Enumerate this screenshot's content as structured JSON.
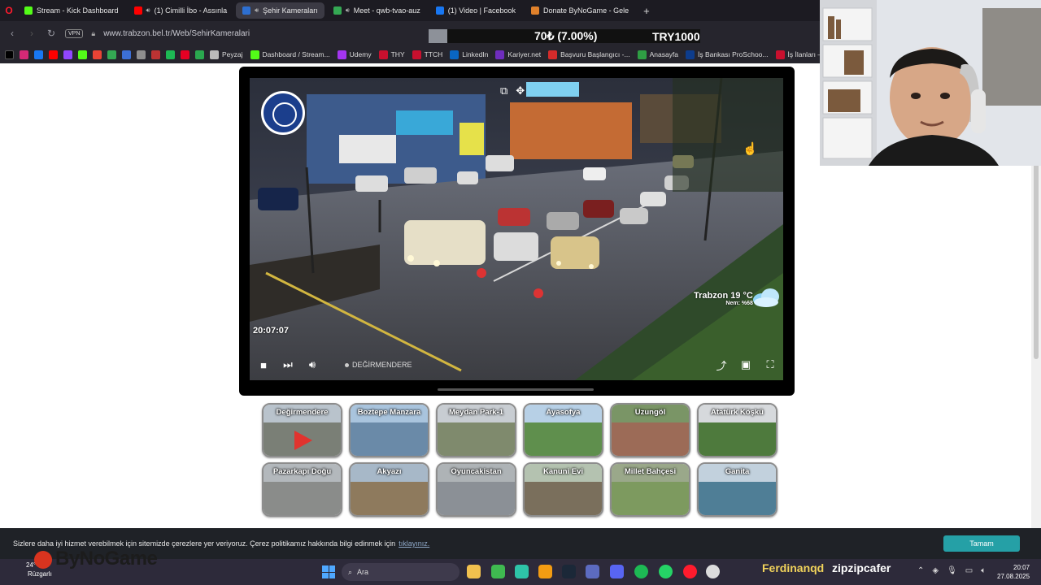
{
  "browser": {
    "tabs": [
      {
        "label": "Stream - Kick Dashboard",
        "color": "#53fc18",
        "audio": false,
        "active": false
      },
      {
        "label": "(1) Cimilli İbo - Assınla",
        "color": "#ff0000",
        "audio": true,
        "active": false
      },
      {
        "label": "Şehir Kameraları",
        "color": "#2d6fd1",
        "audio": true,
        "active": true
      },
      {
        "label": "Meet - qwb-tvao-auz",
        "color": "#34a853",
        "audio": true,
        "active": false
      },
      {
        "label": "(1) Video | Facebook",
        "color": "#1877f2",
        "audio": false,
        "active": false
      },
      {
        "label": "Donate ByNoGame - Gele",
        "color": "#e0812b",
        "audio": false,
        "active": false
      }
    ],
    "new_tab": "+",
    "vpn": "VPN",
    "url": "www.trabzon.bel.tr/Web/SehirKameralari",
    "overlay_goal": "70₺ (7.00%)",
    "overlay_amount": "TRY1000"
  },
  "bookmarks": [
    {
      "label": "Peyzaj",
      "color": "#bbbbbb"
    },
    {
      "label": "Dashboard / Stream...",
      "color": "#53fc18"
    },
    {
      "label": "Udemy",
      "color": "#a435f0"
    },
    {
      "label": "THY",
      "color": "#c8102e"
    },
    {
      "label": "TTCH",
      "color": "#c8102e"
    },
    {
      "label": "LinkedIn",
      "color": "#0a66c2"
    },
    {
      "label": "Kariyer.net",
      "color": "#6f2dbd"
    },
    {
      "label": "Başvuru Başlangıcı -...",
      "color": "#d62b2b"
    },
    {
      "label": "Anasayfa",
      "color": "#2f9e44"
    },
    {
      "label": "İş Bankası ProSchoo...",
      "color": "#0d3c8c"
    },
    {
      "label": "İş İlanları – Ba",
      "color": "#c8102e"
    }
  ],
  "player": {
    "time": "20:07:07",
    "weather_city": "Trabzon 19 °C",
    "weather_humidity": "Nem: %68",
    "live_label": "DEĞİRMENDERE",
    "progress": 0.0
  },
  "cameras": [
    {
      "name": "Değirmendere",
      "sky": "#b9c3cc",
      "ground": "#7a7f76",
      "playing": true
    },
    {
      "name": "Boztepe Manzara",
      "sky": "#a9c4dd",
      "ground": "#6a8aa8",
      "playing": false
    },
    {
      "name": "Meydan Park-1",
      "sky": "#c8cdd2",
      "ground": "#7f8a6d",
      "playing": false
    },
    {
      "name": "Ayasofya",
      "sky": "#b7d0e6",
      "ground": "#5f8f4d",
      "playing": false
    },
    {
      "name": "Uzungöl",
      "sky": "#7a9566",
      "ground": "#9c6b57",
      "playing": false
    },
    {
      "name": "Atatürk Köşkü",
      "sky": "#d6d9dc",
      "ground": "#4e7a3d",
      "playing": false
    },
    {
      "name": "Pazarkapı Doğu",
      "sky": "#b3b8bc",
      "ground": "#8a8c8a",
      "playing": false
    },
    {
      "name": "Akyazı",
      "sky": "#a7b8c8",
      "ground": "#8e7a5d",
      "playing": false
    },
    {
      "name": "Oyuncakistan",
      "sky": "#aeb3b6",
      "ground": "#8b9096",
      "playing": false
    },
    {
      "name": "Kanuni Evi",
      "sky": "#b4c2b0",
      "ground": "#7a6f5c",
      "playing": false
    },
    {
      "name": "Millet Bahçesi",
      "sky": "#9aa88a",
      "ground": "#7d9a5f",
      "playing": false
    },
    {
      "name": "Ganita",
      "sky": "#c2d1dd",
      "ground": "#4f7e96",
      "playing": false
    }
  ],
  "cookie": {
    "message": "Sizlere daha iyi hizmet verebilmek için sitemizde çerezlere yer veriyoruz. Çerez politikamız hakkında bilgi edinmek için",
    "link": "tıklayınız.",
    "accept": "Tamam"
  },
  "taskbar": {
    "weather_temp": "24°",
    "weather_desc": "Rüzgarlı",
    "search_placeholder": "Ara",
    "streamer_name": "Ferdinanqd",
    "streamer_tag": "zipzipcafer",
    "time": "20:07",
    "date": "27.08.2025",
    "watermark": "ByNoGame"
  }
}
